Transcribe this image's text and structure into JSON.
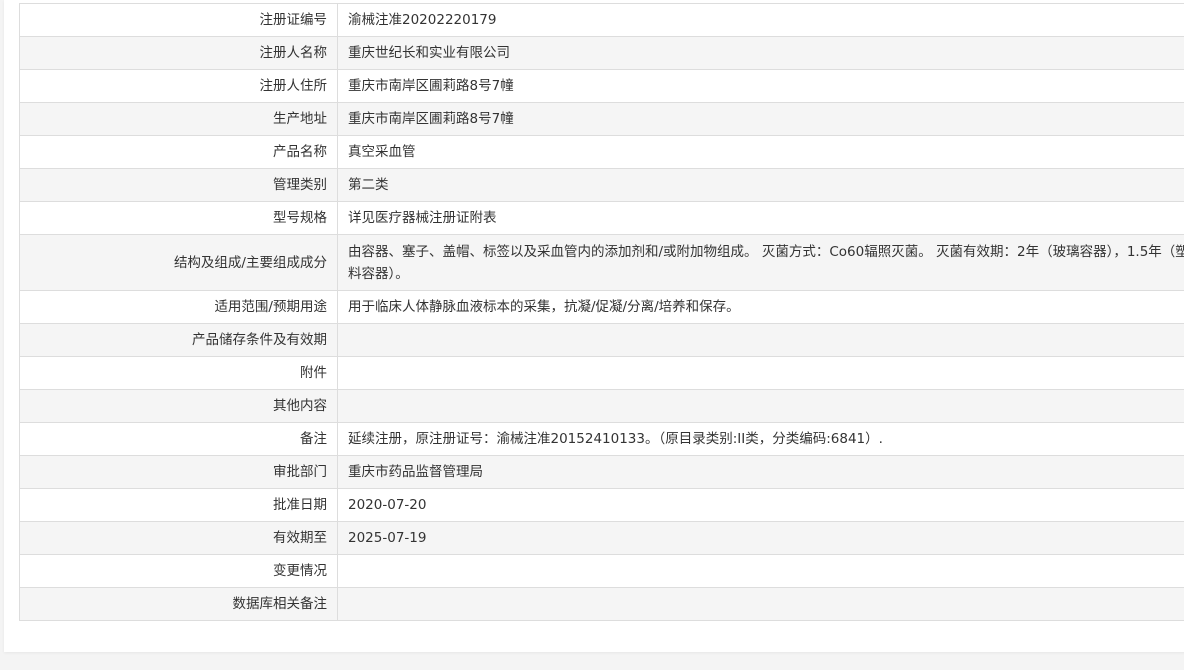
{
  "rows": [
    {
      "label": "注册证编号",
      "value": "渝械注准20202220179"
    },
    {
      "label": "注册人名称",
      "value": "重庆世纪长和实业有限公司"
    },
    {
      "label": "注册人住所",
      "value": "重庆市南岸区圃莉路8号7幢"
    },
    {
      "label": "生产地址",
      "value": "重庆市南岸区圃莉路8号7幢"
    },
    {
      "label": "产品名称",
      "value": "真空采血管"
    },
    {
      "label": "管理类别",
      "value": "第二类"
    },
    {
      "label": "型号规格",
      "value": "详见医疗器械注册证附表"
    },
    {
      "label": "结构及组成/主要组成成分",
      "value": "由容器、塞子、盖帽、标签以及采血管内的添加剂和/或附加物组成。 灭菌方式：Co60辐照灭菌。 灭菌有效期：2年（玻璃容器），1.5年（塑料容器）。"
    },
    {
      "label": "适用范围/预期用途",
      "value": "用于临床人体静脉血液标本的采集，抗凝/促凝/分离/培养和保存。"
    },
    {
      "label": "产品储存条件及有效期",
      "value": ""
    },
    {
      "label": "附件",
      "value": ""
    },
    {
      "label": "其他内容",
      "value": ""
    },
    {
      "label": "备注",
      "value": "延续注册，原注册证号：渝械注准20152410133。（原目录类别:II类，分类编码:6841）."
    },
    {
      "label": "审批部门",
      "value": "重庆市药品监督管理局"
    },
    {
      "label": "批准日期",
      "value": "2020-07-20"
    },
    {
      "label": "有效期至",
      "value": "2025-07-19"
    },
    {
      "label": "变更情况",
      "value": ""
    },
    {
      "label": "数据库相关备注",
      "value": ""
    }
  ]
}
